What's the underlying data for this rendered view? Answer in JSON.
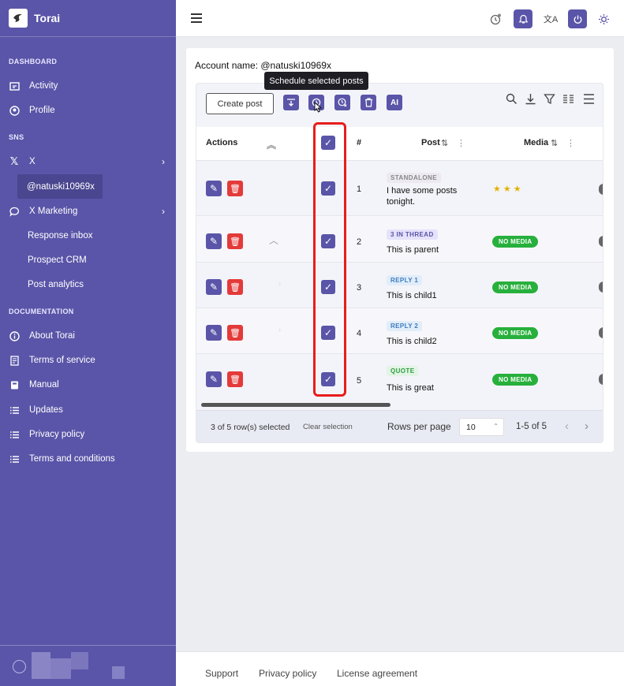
{
  "app": {
    "name": "Torai"
  },
  "sidebar": {
    "sections": {
      "dashboard": "DASHBOARD",
      "sns": "SNS",
      "documentation": "DOCUMENTATION"
    },
    "items": {
      "activity": "Activity",
      "profile": "Profile",
      "x": "X",
      "account": "@natuski10969x",
      "x_marketing": "X Marketing",
      "response_inbox": "Response inbox",
      "prospect_crm": "Prospect CRM",
      "post_analytics": "Post analytics",
      "about": "About Torai",
      "terms_service": "Terms of service",
      "manual": "Manual",
      "updates": "Updates",
      "privacy": "Privacy policy",
      "terms_conditions": "Terms and conditions"
    }
  },
  "main": {
    "account_label": "Account name: @natuski10969x",
    "tooltip": "Schedule selected posts",
    "create_post": "Create post",
    "ai_label": "AI",
    "headers": {
      "actions": "Actions",
      "num": "#",
      "post": "Post",
      "media": "Media"
    },
    "rows": [
      {
        "num": "1",
        "tag": "STANDALONE",
        "text": "I have some posts tonight.",
        "media": ""
      },
      {
        "num": "2",
        "tag": "3 IN THREAD",
        "text": "This is parent",
        "media": "NO MEDIA"
      },
      {
        "num": "3",
        "tag": "REPLY 1",
        "text": "This is child1",
        "media": "NO MEDIA"
      },
      {
        "num": "4",
        "tag": "REPLY 2",
        "text": "This is child2",
        "media": "NO MEDIA"
      },
      {
        "num": "5",
        "tag": "QUOTE",
        "text": "This is great",
        "media": "NO MEDIA"
      }
    ],
    "footer": {
      "selected": "3 of 5 row(s) selected",
      "clear": "Clear selection",
      "rows_per_page": "Rows per page",
      "rows_value": "10",
      "range": "1-5 of 5"
    }
  },
  "page_footer": {
    "support": "Support",
    "privacy": "Privacy policy",
    "license": "License agreement"
  },
  "colors": {
    "brand": "#5a55a8",
    "danger": "#e43a3a",
    "success": "#27b03c",
    "highlight": "#e81c1c"
  }
}
